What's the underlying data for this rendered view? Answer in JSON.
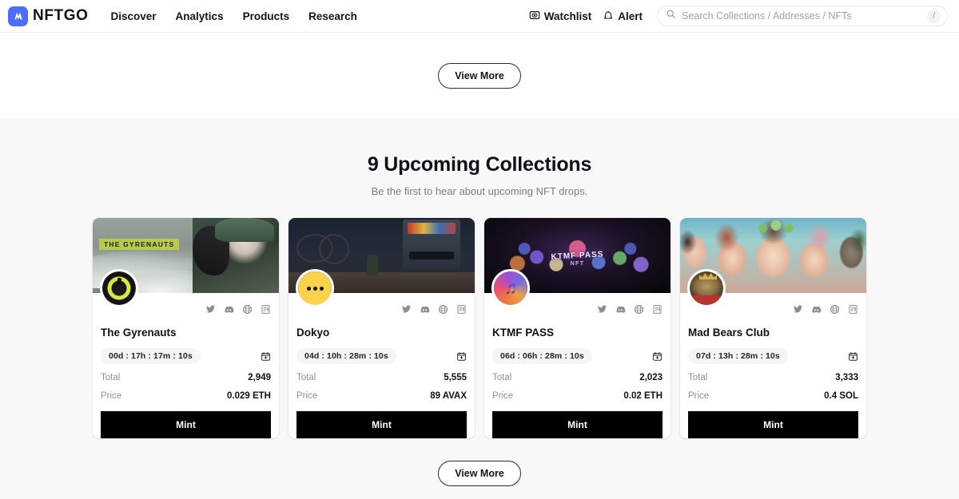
{
  "header": {
    "logo_text": "NFTGO",
    "logo_icon": "nftgo-logo-icon",
    "nav": [
      {
        "label": "Discover"
      },
      {
        "label": "Analytics"
      },
      {
        "label": "Products"
      },
      {
        "label": "Research"
      }
    ],
    "watchlist_label": "Watchlist",
    "watchlist_icon": "eye-watchlist-icon",
    "alert_label": "Alert",
    "alert_icon": "bell-alert-icon",
    "search": {
      "placeholder": "Search Collections / Addresses / NFTs",
      "value": "",
      "icon": "search-icon",
      "shortcut_key": "/"
    }
  },
  "top_section": {
    "view_more_label": "View More"
  },
  "upcoming": {
    "title": "9 Upcoming Collections",
    "subtitle": "Be the first to hear about upcoming NFT drops.",
    "view_more_label": "View More",
    "stat_labels": {
      "total": "Total",
      "price": "Price"
    },
    "mint_label": "Mint",
    "social_icons": [
      "twitter-icon",
      "discord-icon",
      "website-globe-icon",
      "etherscan-icon"
    ],
    "calendar_icon": "calendar-add-icon",
    "cards": [
      {
        "name": "The Gyrenauts",
        "banner_text": "THE GYRENAUTS",
        "countdown": "00d : 17h : 17m : 10s",
        "total": "2,949",
        "price": "0.029 ETH",
        "mint_label": "Mint",
        "avatar_icon": "gyrenauts-avatar"
      },
      {
        "name": "Dokyo",
        "banner_text": "",
        "countdown": "04d : 10h : 28m : 10s",
        "total": "5,555",
        "price": "89 AVAX",
        "mint_label": "Mint",
        "avatar_icon": "dokyo-avatar"
      },
      {
        "name": "KTMF PASS",
        "banner_text": "KTMF PASS",
        "banner_subtext": "NFT",
        "countdown": "06d : 06h : 28m : 10s",
        "total": "2,023",
        "price": "0.02 ETH",
        "mint_label": "Mint",
        "avatar_icon": "ktmf-avatar"
      },
      {
        "name": "Mad Bears Club",
        "banner_text": "",
        "countdown": "07d : 13h : 28m : 10s",
        "total": "3,333",
        "price": "0.4 SOL",
        "mint_label": "Mint",
        "avatar_icon": "madbears-avatar"
      }
    ]
  },
  "colors": {
    "brand_blue": "#4f6ef7",
    "page_bg": "#ffffff",
    "section_bg": "#f8f8f8",
    "mint_button": "#000000",
    "muted_text": "#8e8e99"
  }
}
